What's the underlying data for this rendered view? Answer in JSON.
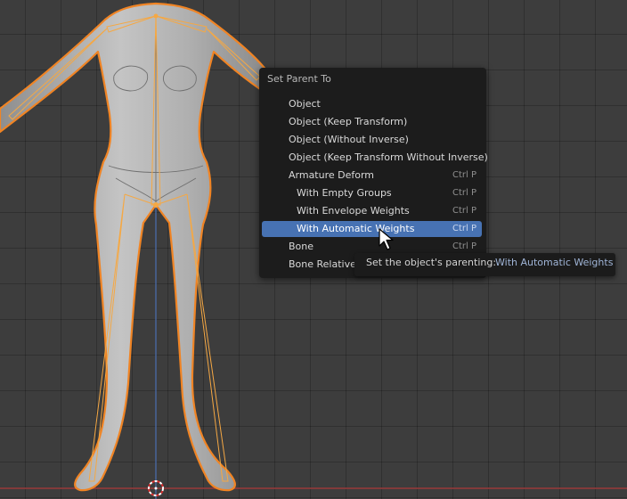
{
  "menu": {
    "title": "Set Parent To",
    "items": [
      {
        "label": "Object",
        "shortcut": ""
      },
      {
        "label": "Object (Keep Transform)",
        "shortcut": ""
      },
      {
        "label": "Object (Without Inverse)",
        "shortcut": ""
      },
      {
        "label": "Object (Keep Transform Without Inverse)",
        "shortcut": ""
      },
      {
        "label": "Armature Deform",
        "shortcut": "Ctrl P"
      },
      {
        "label": "With Empty Groups",
        "shortcut": "Ctrl P"
      },
      {
        "label": "With Envelope Weights",
        "shortcut": "Ctrl P"
      },
      {
        "label": "With Automatic Weights",
        "shortcut": "Ctrl P"
      },
      {
        "label": "Bone",
        "shortcut": "Ctrl P"
      },
      {
        "label": "Bone Relative",
        "shortcut": ""
      }
    ]
  },
  "tooltip": {
    "text": "Set the object's parenting:",
    "value": "With Automatic Weights"
  },
  "colors": {
    "highlight": "#4772b3",
    "selection_outline": "#f08424",
    "bone_outline": "#f5a844",
    "x_axis": "#9a3a3a",
    "z_axis": "#4a6aa8"
  },
  "icons": [
    "mouse-pointer-icon",
    "3d-cursor-icon"
  ]
}
